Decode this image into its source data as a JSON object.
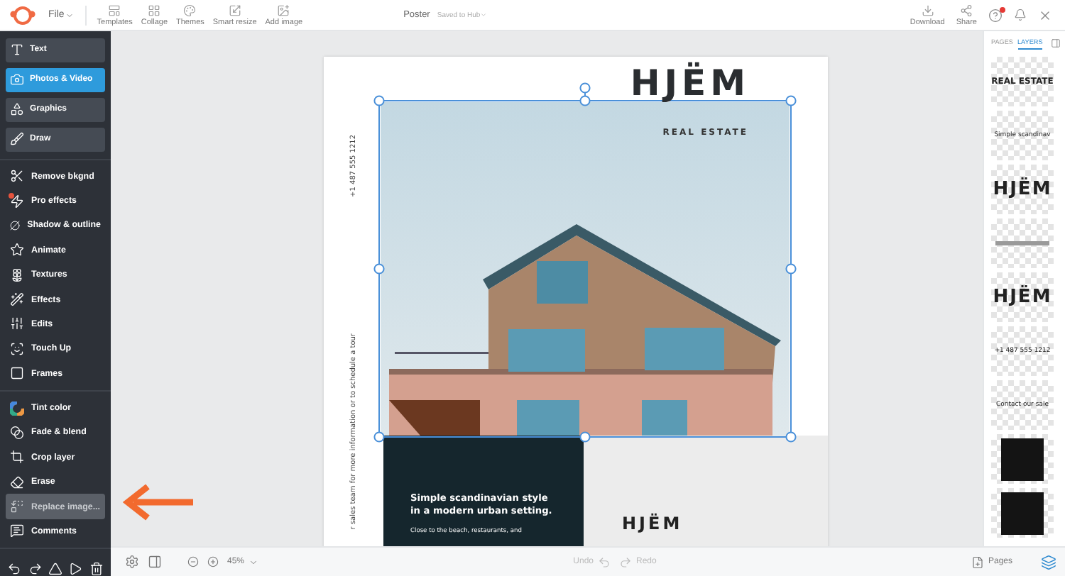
{
  "topbar": {
    "menu": "File",
    "tools": [
      "Templates",
      "Collage",
      "Themes",
      "Smart resize",
      "Add image"
    ],
    "document": {
      "title": "Poster",
      "status": "Saved to Hub"
    },
    "actions": [
      "Download",
      "Share"
    ],
    "notification": true
  },
  "sidebar": {
    "primary": [
      {
        "label": "Text",
        "selected": false
      },
      {
        "label": "Photos & Video",
        "selected": true
      },
      {
        "label": "Graphics",
        "selected": false
      },
      {
        "label": "Draw",
        "selected": false
      }
    ],
    "groups": [
      [
        {
          "label": "Remove bkgnd",
          "selected": false,
          "badge": false
        },
        {
          "label": "Pro effects",
          "selected": false,
          "badge": true
        },
        {
          "label": "Shadow & outline",
          "selected": false,
          "badge": false
        },
        {
          "label": "Animate",
          "selected": false,
          "badge": false
        },
        {
          "label": "Textures",
          "selected": false,
          "badge": false
        },
        {
          "label": "Effects",
          "selected": false,
          "badge": false
        },
        {
          "label": "Edits",
          "selected": false,
          "badge": false
        },
        {
          "label": "Touch Up",
          "selected": false,
          "badge": false
        },
        {
          "label": "Frames",
          "selected": false,
          "badge": false
        }
      ],
      [
        {
          "label": "Tint color",
          "selected": false,
          "badge": false
        },
        {
          "label": "Fade & blend",
          "selected": false,
          "badge": false
        },
        {
          "label": "Crop layer",
          "selected": false,
          "badge": false
        },
        {
          "label": "Erase",
          "selected": false,
          "badge": false
        },
        {
          "label": "Replace image...",
          "selected": true,
          "badge": false
        },
        {
          "label": "Comments",
          "selected": false,
          "badge": false
        }
      ]
    ]
  },
  "poster": {
    "brand": "HJËM",
    "tagline": "REAL ESTATE",
    "phone": "+1 487 555 1212",
    "side_note": "r sales team for more information or to schedule a tour",
    "headline": "Simple scandinavian style in a modern urban setting.",
    "body": "Close to the beach, restaurants, and",
    "footer_brand": "HJËM",
    "photo_selected": true
  },
  "panel": {
    "tabs": [
      {
        "label": "PAGES",
        "selected": false
      },
      {
        "label": "LAYERS",
        "selected": true
      }
    ],
    "layers": [
      {
        "kind": "text",
        "text": "REAL ESTATE"
      },
      {
        "kind": "text",
        "text": "Simple scandinav"
      },
      {
        "kind": "title",
        "text": "HJËM"
      },
      {
        "kind": "scribble"
      },
      {
        "kind": "title",
        "text": "HJËM"
      },
      {
        "kind": "text",
        "text": "+1 487 555 1212"
      },
      {
        "kind": "text",
        "text": "Contact our sale"
      },
      {
        "kind": "shape"
      },
      {
        "kind": "shape"
      }
    ]
  },
  "bottombar": {
    "zoom": "45%",
    "undo": "Undo",
    "redo": "Redo",
    "history_disabled": true,
    "pages": "Pages"
  }
}
